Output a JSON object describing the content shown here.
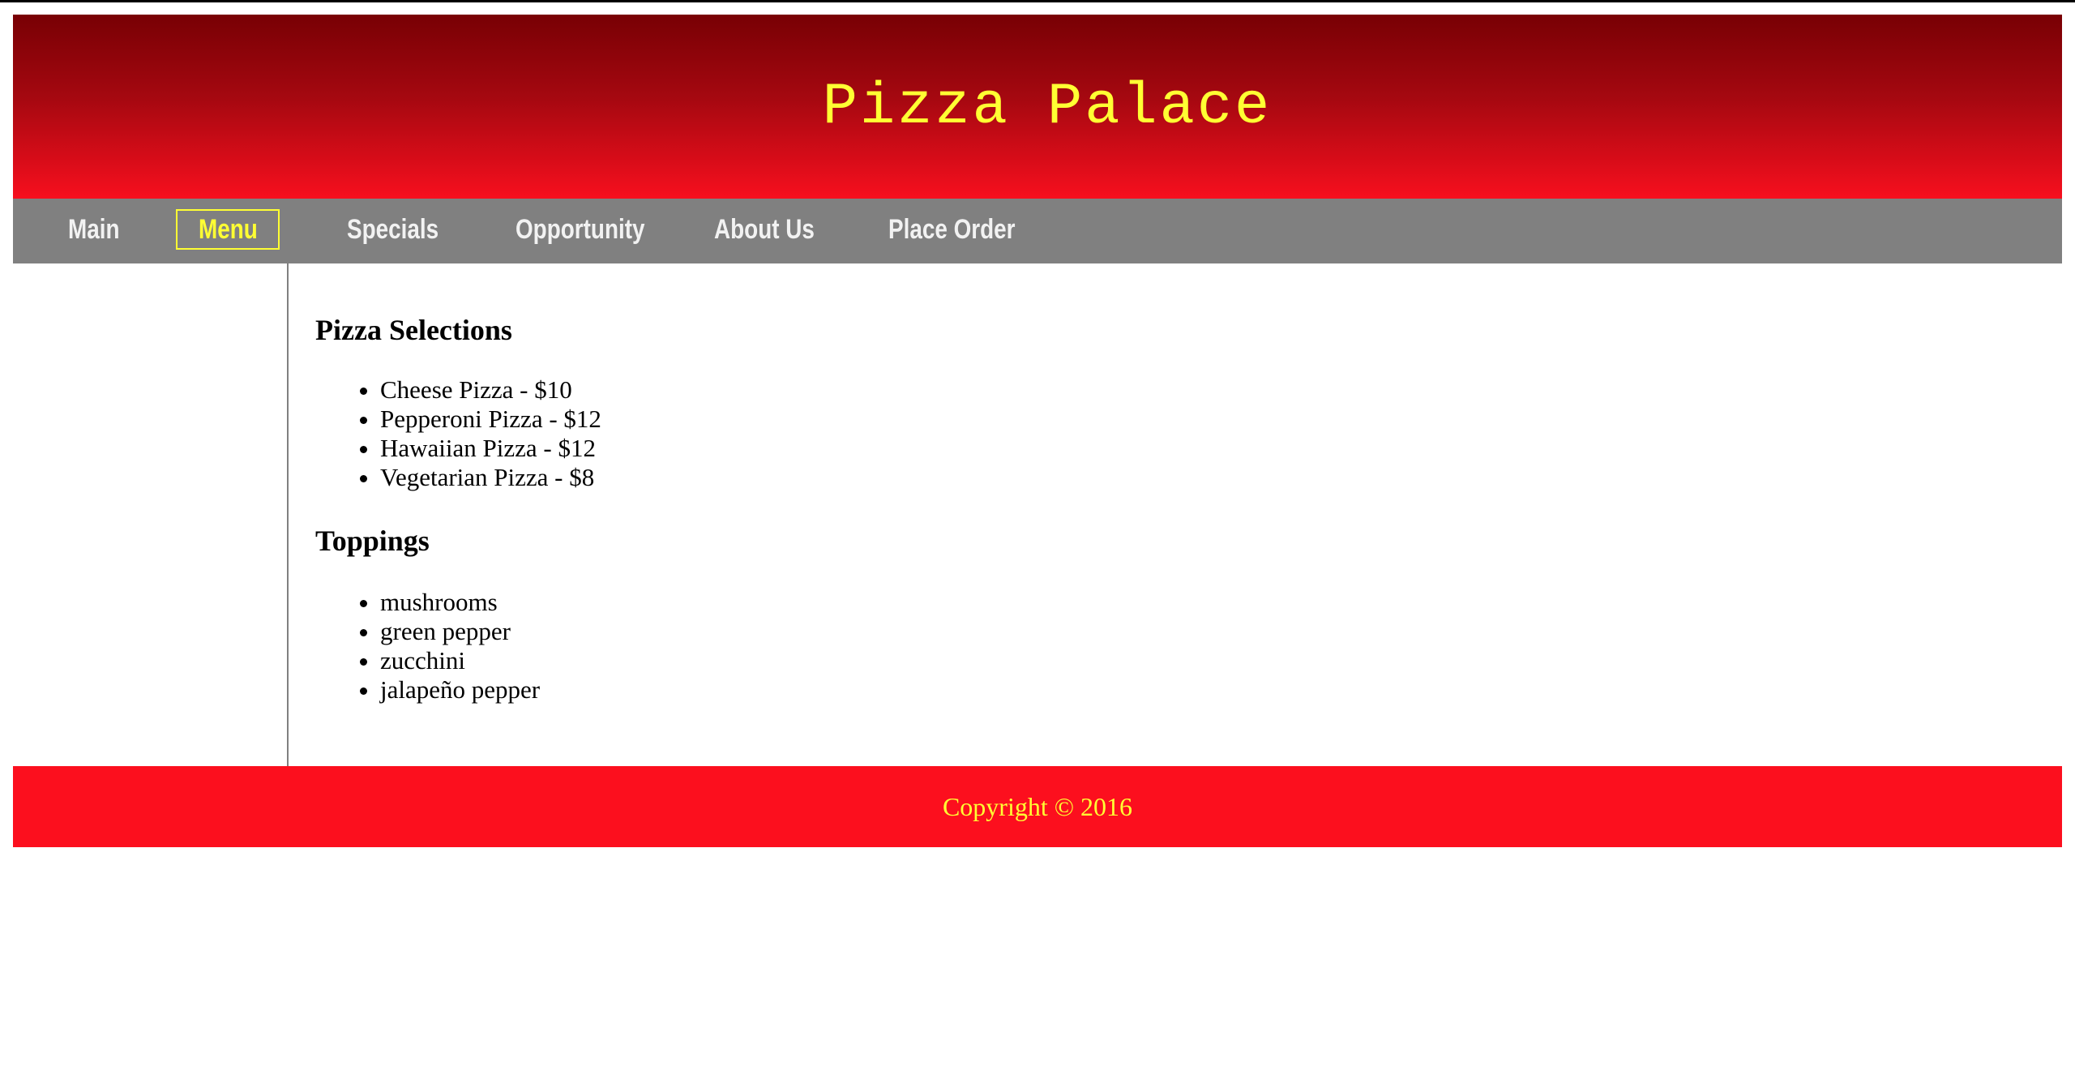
{
  "header": {
    "title": "Pizza Palace"
  },
  "nav": {
    "items": [
      {
        "label": "Main"
      },
      {
        "label": "Menu"
      },
      {
        "label": "Specials"
      },
      {
        "label": "Opportunity"
      },
      {
        "label": "About Us"
      },
      {
        "label": "Place Order"
      }
    ],
    "active": "Menu"
  },
  "main": {
    "pizza_heading": "Pizza Selections",
    "pizzas": [
      "Cheese Pizza - $10",
      "Pepperoni Pizza - $12",
      "Hawaiian Pizza - $12",
      "Vegetarian Pizza - $8"
    ],
    "toppings_heading": "Toppings",
    "toppings": [
      "mushrooms",
      "green pepper",
      "zucchini",
      "jalapeño pepper"
    ]
  },
  "footer": {
    "copyright": "Copyright © 2016"
  },
  "colors": {
    "banner_dark": "#780004",
    "banner_light": "#f70f1e",
    "nav_bg": "#808080",
    "accent_yellow": "#ffff33",
    "footer_bg": "#fc0f1e"
  }
}
